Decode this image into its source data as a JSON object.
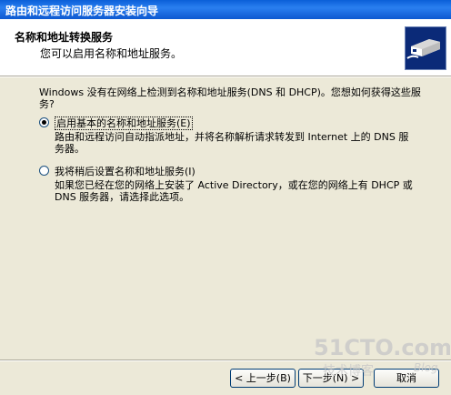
{
  "window": {
    "title": "路由和远程访问服务器安装向导"
  },
  "header": {
    "title": "名称和地址转换服务",
    "subtitle": "您可以启用名称和地址服务。",
    "icon": "network-cable-icon"
  },
  "body": {
    "question": "Windows 没有在网络上检测到名称和地址服务(DNS 和 DHCP)。您想如何获得这些服务?",
    "options": [
      {
        "label": "启用基本的名称和地址服务(E)",
        "description": "路由和远程访问自动指派地址，并将名称解析请求转发到 Internet 上的 DNS 服务器。",
        "selected": true
      },
      {
        "label": "我将稍后设置名称和地址服务(I)",
        "description": "如果您已经在您的网络上安装了 Active Directory，或在您的网络上有 DHCP 或 DNS 服务器，请选择此选项。",
        "selected": false
      }
    ]
  },
  "buttons": {
    "back": "< 上一步(B)",
    "next": "下一步(N) >",
    "cancel": "取消"
  },
  "watermark": {
    "site": "51CTO.com",
    "caption": "技术博客",
    "blog": "Blog"
  }
}
